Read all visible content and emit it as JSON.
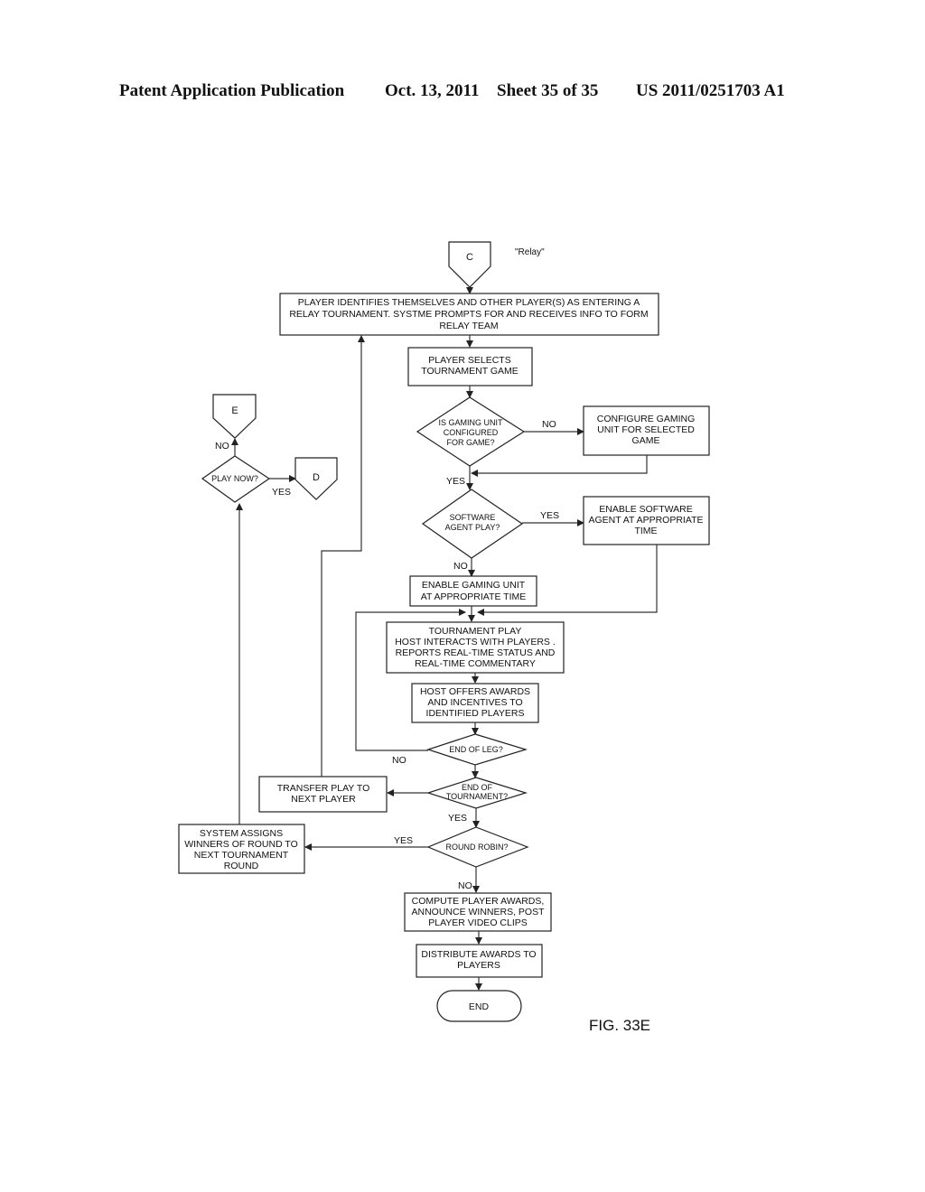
{
  "header": {
    "publication": "Patent Application Publication",
    "date": "Oct. 13, 2011",
    "sheet": "Sheet 35 of 35",
    "number": "US 2011/0251703 A1"
  },
  "figure": {
    "label": "FIG. 33E",
    "subtitle": "\"Relay\""
  },
  "connectors": {
    "c": "C",
    "d": "D",
    "e": "E"
  },
  "steps": {
    "identify": [
      "PLAYER IDENTIFIES THEMSELVES AND OTHER PLAYER(S) AS ENTERING A",
      "RELAY TOURNAMENT.  SYSTME PROMPTS FOR AND RECEIVES INFO TO FORM",
      "RELAY TEAM"
    ],
    "select_game": [
      "PLAYER SELECTS",
      "TOURNAMENT GAME"
    ],
    "configure": [
      "CONFIGURE GAMING",
      "UNIT FOR SELECTED",
      "GAME"
    ],
    "enable_agent": [
      "ENABLE SOFTWARE",
      "AGENT AT APPROPRIATE",
      "TIME"
    ],
    "enable_unit": [
      "ENABLE GAMING UNIT",
      "AT APPROPRIATE TIME"
    ],
    "tournament_play": [
      "TOURNAMENT PLAY",
      "HOST INTERACTS WITH PLAYERS .",
      "REPORTS REAL-TIME STATUS AND",
      "REAL-TIME COMMENTARY"
    ],
    "host_awards": [
      "HOST OFFERS AWARDS",
      "AND INCENTIVES TO",
      "IDENTIFIED PLAYERS"
    ],
    "transfer": [
      "TRANSFER PLAY TO",
      "NEXT PLAYER"
    ],
    "assign_winners": [
      "SYSTEM ASSIGNS",
      "WINNERS OF ROUND TO",
      "NEXT TOURNAMENT",
      "ROUND"
    ],
    "compute": [
      "COMPUTE PLAYER AWARDS,",
      "ANNOUNCE WINNERS, POST",
      "PLAYER VIDEO CLIPS"
    ],
    "distribute": [
      "DISTRIBUTE AWARDS TO",
      "PLAYERS"
    ],
    "end": "END"
  },
  "decisions": {
    "configured": [
      "IS GAMING UNIT",
      "CONFIGURED",
      "FOR GAME?"
    ],
    "agent_play": [
      "SOFTWARE",
      "AGENT PLAY?"
    ],
    "play_now": [
      "PLAY NOW?"
    ],
    "end_of_leg": [
      "END OF LEG?"
    ],
    "end_of_tournament": [
      "END OF",
      "TOURNAMENT?"
    ],
    "round_robin": [
      "ROUND ROBIN?"
    ]
  },
  "edge_labels": {
    "configured_no": "NO",
    "configured_yes": "YES",
    "agent_yes": "YES",
    "agent_no": "NO",
    "play_now_no": "NO",
    "play_now_yes": "YES",
    "leg_no": "NO",
    "tournament_yes": "YES",
    "round_robin_yes": "YES",
    "round_robin_no": "NO"
  }
}
